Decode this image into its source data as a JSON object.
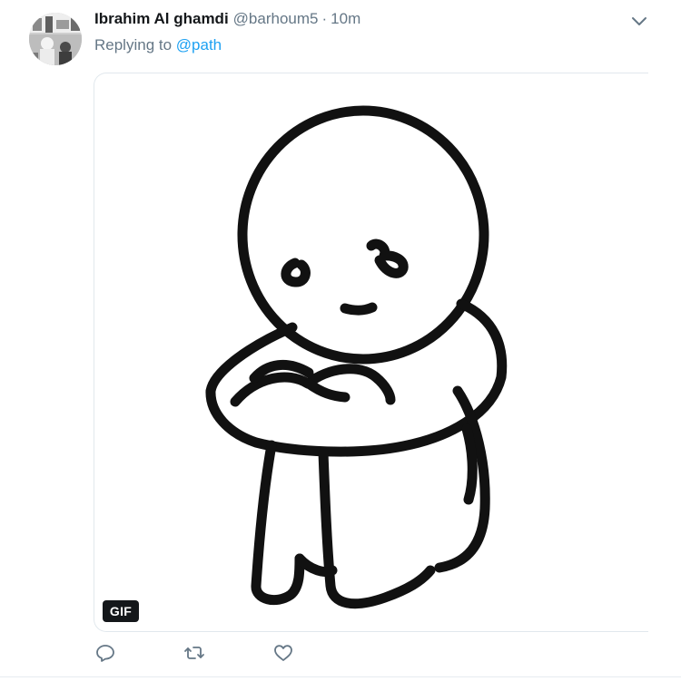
{
  "tweet": {
    "author": {
      "display_name": "Ibrahim Al ghamdi",
      "handle": "@barhoum5",
      "separator": "·",
      "time": "10m"
    },
    "replying": {
      "prefix": "Replying to",
      "mention": "@path"
    },
    "media": {
      "badge": "GIF"
    },
    "actions": {
      "reply_icon": "reply-icon",
      "retweet_icon": "retweet-icon",
      "like_icon": "like-icon"
    },
    "menu_icon": "chevron-down-icon",
    "colors": {
      "text": "#14171a",
      "secondary": "#657786",
      "link": "#1da1f2",
      "border": "#e1e8ed"
    }
  }
}
